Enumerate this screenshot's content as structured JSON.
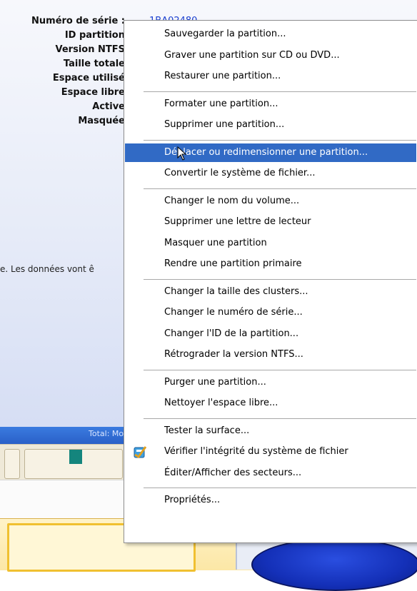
{
  "properties": {
    "labels": [
      "Numéro de série :",
      "ID partition",
      "Version NTFS",
      "Taille totale",
      "Espace utilisé",
      "Espace libre",
      "Active",
      "Masquée"
    ],
    "serial_value": "1BA02480"
  },
  "warning_text": "e. Les données vont ê",
  "bottom_bar_label": "Total: Mo",
  "menu": {
    "groups": [
      [
        "Sauvegarder la partition...",
        "Graver une partition sur CD ou DVD...",
        "Restaurer une partition..."
      ],
      [
        "Formater une partition...",
        "Supprimer une partition..."
      ],
      [
        "Déplacer ou redimensionner une partition...",
        "Convertir le système de fichier..."
      ],
      [
        "Changer le nom du volume...",
        "Supprimer une lettre de lecteur",
        "Masquer une partition",
        "Rendre une partition primaire"
      ],
      [
        "Changer la taille des clusters...",
        "Changer le numéro de série...",
        "Changer l'ID de la partition...",
        "Rétrograder la version NTFS..."
      ],
      [
        "Purger une partition...",
        "Nettoyer l'espace libre..."
      ],
      [
        "Tester la surface...",
        "Vérifier l'intégrité du système de fichier",
        "Éditer/Afficher des secteurs..."
      ],
      [
        "Propriétés..."
      ]
    ],
    "highlighted": "Déplacer ou redimensionner une partition...",
    "item_with_icon": "Vérifier l'intégrité du système de fichier",
    "icon_name": "check-disk-icon",
    "highlight_color": "#316ac5"
  }
}
